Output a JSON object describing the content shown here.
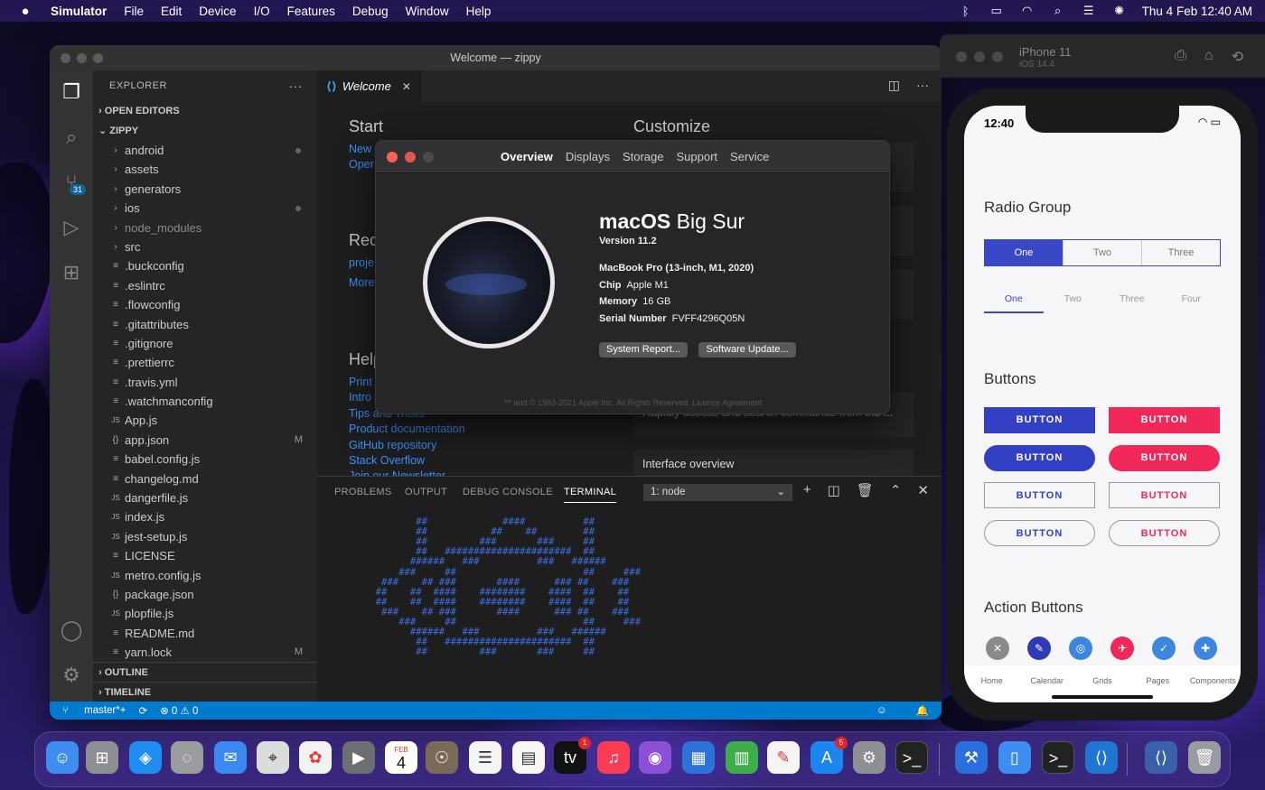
{
  "menubar": {
    "app": "Simulator",
    "items": [
      "File",
      "Edit",
      "Device",
      "I/O",
      "Features",
      "Debug",
      "Window",
      "Help"
    ],
    "clock": "Thu 4 Feb  12:40 AM"
  },
  "vscode": {
    "title": "Welcome — zippy",
    "explorer_label": "EXPLORER",
    "open_editors": "OPEN EDITORS",
    "project": "ZIPPY",
    "scm_badge": "31",
    "tree": [
      {
        "name": "android",
        "kind": "folder",
        "git": "dot"
      },
      {
        "name": "assets",
        "kind": "folder",
        "git": ""
      },
      {
        "name": "generators",
        "kind": "folder",
        "git": ""
      },
      {
        "name": "ios",
        "kind": "folder",
        "git": "dot"
      },
      {
        "name": "node_modules",
        "kind": "folder",
        "git": "",
        "dim": true
      },
      {
        "name": "src",
        "kind": "folder",
        "git": ""
      },
      {
        "name": ".buckconfig",
        "kind": "file",
        "git": ""
      },
      {
        "name": ".eslintrc",
        "kind": "file",
        "git": ""
      },
      {
        "name": ".flowconfig",
        "kind": "file",
        "git": ""
      },
      {
        "name": ".gitattributes",
        "kind": "file",
        "git": ""
      },
      {
        "name": ".gitignore",
        "kind": "file",
        "git": ""
      },
      {
        "name": ".prettierrc",
        "kind": "file",
        "git": ""
      },
      {
        "name": ".travis.yml",
        "kind": "file",
        "git": ""
      },
      {
        "name": ".watchmanconfig",
        "kind": "file",
        "git": ""
      },
      {
        "name": "App.js",
        "kind": "js",
        "git": ""
      },
      {
        "name": "app.json",
        "kind": "json",
        "git": "M"
      },
      {
        "name": "babel.config.js",
        "kind": "file",
        "git": ""
      },
      {
        "name": "changelog.md",
        "kind": "file",
        "git": ""
      },
      {
        "name": "dangerfile.js",
        "kind": "js",
        "git": ""
      },
      {
        "name": "index.js",
        "kind": "js",
        "git": ""
      },
      {
        "name": "jest-setup.js",
        "kind": "js",
        "git": ""
      },
      {
        "name": "LICENSE",
        "kind": "file",
        "git": ""
      },
      {
        "name": "metro.config.js",
        "kind": "js",
        "git": ""
      },
      {
        "name": "package.json",
        "kind": "json",
        "git": ""
      },
      {
        "name": "plopfile.js",
        "kind": "js",
        "git": ""
      },
      {
        "name": "README.md",
        "kind": "file",
        "git": ""
      },
      {
        "name": "yarn.lock",
        "kind": "file",
        "git": "M"
      }
    ],
    "outline": "OUTLINE",
    "timeline": "TIMELINE",
    "tab_label": "Welcome",
    "welcome": {
      "start": "Start",
      "customize": "Customize",
      "new": "New",
      "open": "Oper",
      "recent": "Rec",
      "recent_link": "proje",
      "more": "More",
      "help": "Help",
      "help_links": [
        "Print",
        "Intro",
        "Tips and Tricks",
        "Product documentation",
        "GitHub repository",
        "Stack Overflow",
        "Join our Newsletter"
      ],
      "commands_desc": "Rapidly access and search commands from the ...",
      "interface_overview": "Interface overview"
    },
    "panel_tabs": [
      "PROBLEMS",
      "OUTPUT",
      "DEBUG CONSOLE",
      "TERMINAL"
    ],
    "terminal_select": "1: node",
    "status": {
      "branch": "master*+",
      "problems": "⊗ 0 ⚠ 0"
    }
  },
  "about": {
    "tabs": [
      "Overview",
      "Displays",
      "Storage",
      "Support",
      "Service"
    ],
    "os_bold": "macOS",
    "os_name": "Big Sur",
    "version": "Version 11.2",
    "model": "MacBook Pro (13-inch, M1, 2020)",
    "chip_label": "Chip",
    "chip": "Apple M1",
    "memory_label": "Memory",
    "memory": "16 GB",
    "serial_label": "Serial Number",
    "serial": "FVFF4296Q05N",
    "system_report": "System Report...",
    "software_update": "Software Update...",
    "footer": "™ and © 1983-2021 Apple Inc. All Rights Reserved. Licence Agreement"
  },
  "simulator": {
    "device": "iPhone 11",
    "os": "iOS 14.4",
    "time": "12:40",
    "radio_group": "Radio Group",
    "segments": [
      "One",
      "Two",
      "Three"
    ],
    "tabs": [
      "One",
      "Two",
      "Three",
      "Four"
    ],
    "buttons_title": "Buttons",
    "button_label": "BUTTON",
    "action_buttons": "Action Buttons",
    "bottom_nav": [
      "Home",
      "Calendar",
      "Grids",
      "Pages",
      "Components"
    ]
  },
  "dock": {
    "calendar_month": "FEB",
    "calendar_day": "4",
    "tv_badge": "1",
    "appstore_badge": "5"
  }
}
